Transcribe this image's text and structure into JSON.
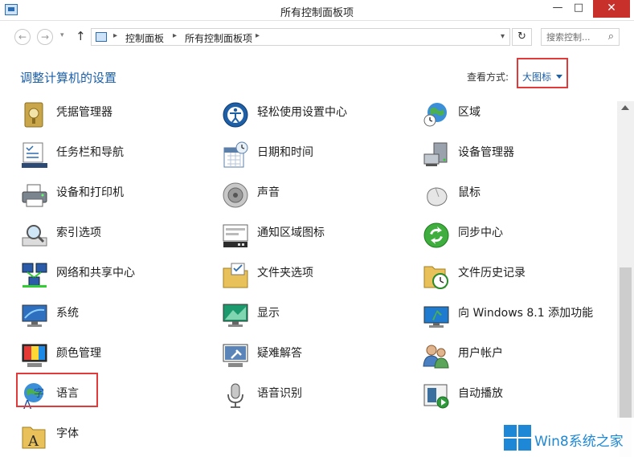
{
  "window": {
    "title": "所有控制面板项",
    "minimize": "—",
    "maximize": "□",
    "close": "✕"
  },
  "nav": {
    "back": "←",
    "forward": "→",
    "recent": "▾",
    "up": "↑",
    "refresh": "↻"
  },
  "address": {
    "separator": "▸",
    "crumbs": [
      "控制面板",
      "所有控制面板项"
    ],
    "dropdown": "▾"
  },
  "search": {
    "placeholder": "搜索控制...",
    "icon": "⌕"
  },
  "header": {
    "title": "调整计算机的设置",
    "view_by_label": "查看方式:",
    "view_by_value": "大图标"
  },
  "items": [
    {
      "label": "凭据管理器",
      "icon": "credential-manager-icon"
    },
    {
      "label": "轻松使用设置中心",
      "icon": "ease-of-access-icon"
    },
    {
      "label": "区域",
      "icon": "region-globe-icon"
    },
    {
      "label": "任务栏和导航",
      "icon": "taskbar-icon"
    },
    {
      "label": "日期和时间",
      "icon": "calendar-clock-icon"
    },
    {
      "label": "设备管理器",
      "icon": "device-manager-icon"
    },
    {
      "label": "设备和打印机",
      "icon": "printer-icon"
    },
    {
      "label": "声音",
      "icon": "speaker-icon"
    },
    {
      "label": "鼠标",
      "icon": "mouse-icon"
    },
    {
      "label": "索引选项",
      "icon": "indexing-magnifier-icon"
    },
    {
      "label": "通知区域图标",
      "icon": "notification-area-icon"
    },
    {
      "label": "同步中心",
      "icon": "sync-center-icon"
    },
    {
      "label": "网络和共享中心",
      "icon": "network-icon"
    },
    {
      "label": "文件夹选项",
      "icon": "folder-options-icon"
    },
    {
      "label": "文件历史记录",
      "icon": "file-history-icon"
    },
    {
      "label": "系统",
      "icon": "system-monitor-icon"
    },
    {
      "label": "显示",
      "icon": "display-icon"
    },
    {
      "label": "向 Windows 8.1 添加功能",
      "icon": "add-features-icon"
    },
    {
      "label": "颜色管理",
      "icon": "color-management-icon"
    },
    {
      "label": "疑难解答",
      "icon": "troubleshooting-icon"
    },
    {
      "label": "用户帐户",
      "icon": "user-accounts-icon"
    },
    {
      "label": "语言",
      "icon": "language-icon"
    },
    {
      "label": "语音识别",
      "icon": "microphone-icon"
    },
    {
      "label": "自动播放",
      "icon": "autoplay-icon"
    },
    {
      "label": "字体",
      "icon": "fonts-icon"
    }
  ],
  "watermark": {
    "text": "Win8系统之家",
    "icon": "windows-logo-icon"
  },
  "colors": {
    "link": "#1b5fa8",
    "highlight": "#e03a3a",
    "close": "#c7302b",
    "watermark": "#1e88d6"
  }
}
